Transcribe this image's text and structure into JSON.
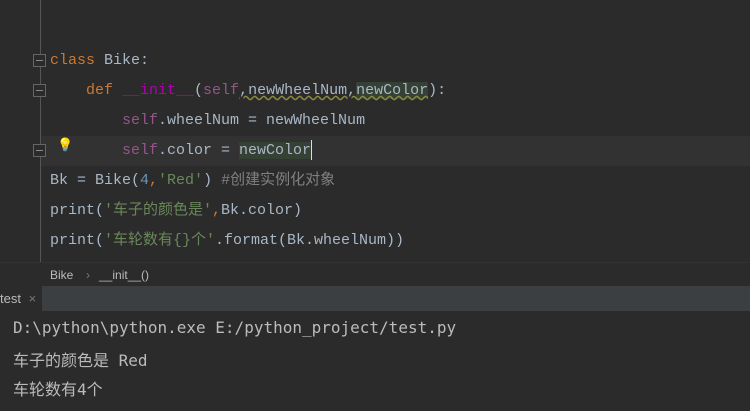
{
  "editor": {
    "lines": [
      [
        {
          "t": "class ",
          "c": "kw"
        },
        {
          "t": "Bike:",
          "c": ""
        }
      ],
      [
        {
          "t": "    def ",
          "c": "kw"
        },
        {
          "t": "__init__",
          "c": "magic"
        },
        {
          "t": "(",
          "c": ""
        },
        {
          "t": "self",
          "c": "self"
        },
        {
          "t": ",newWheelNum,",
          "c": "warn"
        },
        {
          "t": "newColor",
          "c": "hl warn"
        },
        {
          "t": "):",
          "c": ""
        }
      ],
      [
        {
          "t": "        ",
          "c": ""
        },
        {
          "t": "self",
          "c": "self"
        },
        {
          "t": ".wheelNum = newWheelNum",
          "c": ""
        }
      ],
      [
        {
          "t": "        ",
          "c": ""
        },
        {
          "t": "self",
          "c": "self"
        },
        {
          "t": ".color = ",
          "c": ""
        },
        {
          "t": "newColor",
          "c": "hl"
        }
      ],
      [
        {
          "t": "Bk = Bike(",
          "c": ""
        },
        {
          "t": "4",
          "c": "num"
        },
        {
          "t": ",",
          "c": "kw"
        },
        {
          "t": "'Red'",
          "c": "str"
        },
        {
          "t": ") ",
          "c": ""
        },
        {
          "t": "#创建实例化对象",
          "c": "cmt"
        }
      ],
      [
        {
          "t": "print(",
          "c": ""
        },
        {
          "t": "'车子的颜色是'",
          "c": "str"
        },
        {
          "t": ",",
          "c": "kw"
        },
        {
          "t": "Bk.color)",
          "c": ""
        }
      ],
      [
        {
          "t": "print(",
          "c": ""
        },
        {
          "t": "'车轮数有{}个'",
          "c": "str"
        },
        {
          "t": ".format(Bk.wheelNum))",
          "c": ""
        }
      ]
    ]
  },
  "breadcrumb": {
    "items": [
      "Bike",
      "__init__()"
    ],
    "separator": "›"
  },
  "run_tab": {
    "label": "test",
    "close": "×"
  },
  "console": {
    "lines": [
      "D:\\python\\python.exe E:/python_project/test.py",
      "车子的颜色是 Red",
      "车轮数有4个"
    ]
  }
}
